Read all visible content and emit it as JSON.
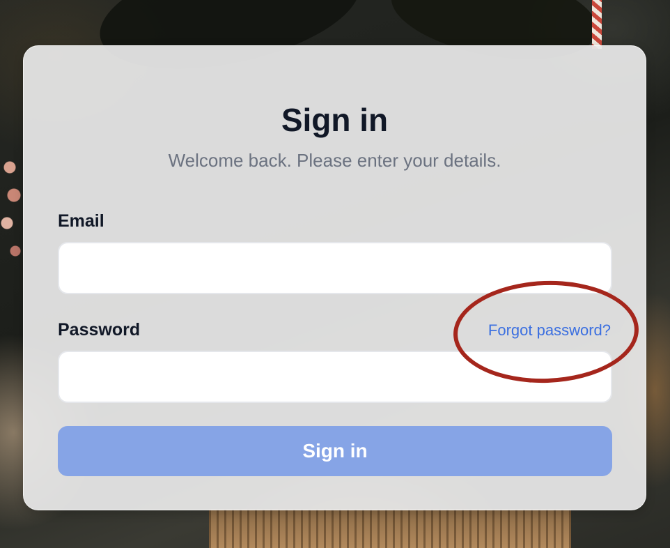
{
  "signin": {
    "title": "Sign in",
    "subtitle": "Welcome back. Please enter your details.",
    "email_label": "Email",
    "email_value": "",
    "password_label": "Password",
    "password_value": "",
    "forgot_link": "Forgot password?",
    "submit_label": "Sign in"
  },
  "colors": {
    "title": "#111827",
    "subtitle": "#6b7280",
    "link": "#3b6fe0",
    "button": "#86a4e6",
    "annotation": "#a5261c"
  }
}
